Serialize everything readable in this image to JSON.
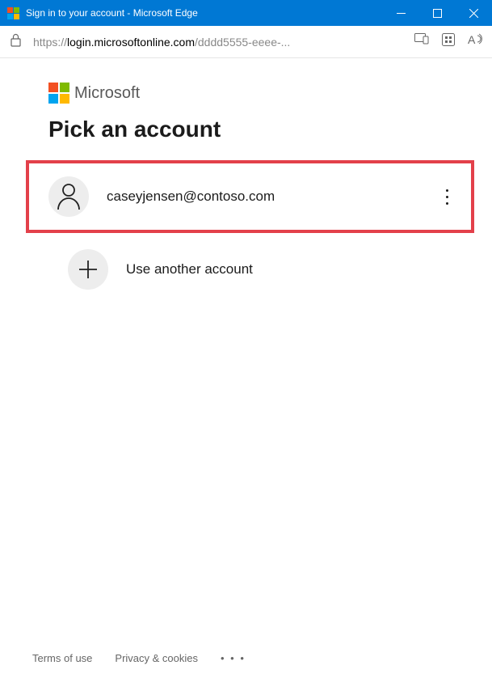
{
  "window": {
    "title": "Sign in to your account - Microsoft Edge"
  },
  "addressbar": {
    "protocol": "https://",
    "domain": "login.microsoftonline.com",
    "path": "/dddd5555-eeee-..."
  },
  "brand": {
    "name": "Microsoft"
  },
  "page": {
    "heading": "Pick an account"
  },
  "accounts": [
    {
      "email": "caseyjensen@contoso.com"
    }
  ],
  "use_another": {
    "label": "Use another account"
  },
  "footer": {
    "terms": "Terms of use",
    "privacy": "Privacy & cookies"
  },
  "colors": {
    "ms_red": "#F25022",
    "ms_green": "#7FBA00",
    "ms_blue": "#00A4EF",
    "ms_yellow": "#FFB900",
    "titlebar": "#0078D4",
    "highlight": "#E3404A"
  }
}
